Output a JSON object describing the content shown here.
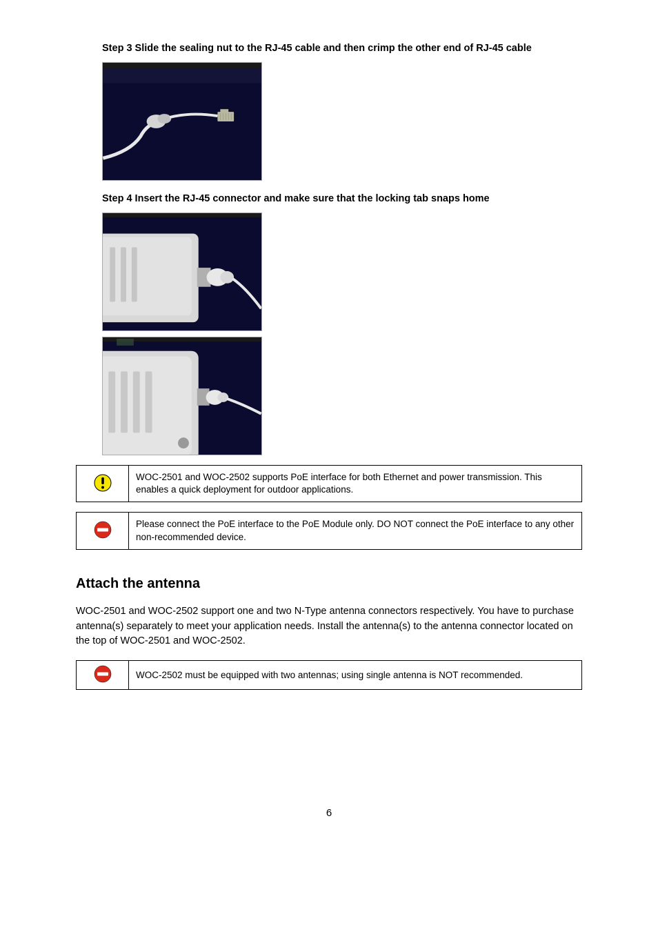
{
  "step3": {
    "header": "Step 3 Slide the sealing nut to the RJ-45 cable and then crimp the other end of RJ-45 cable",
    "alt": "RJ-45 cable with sealing nut and connector"
  },
  "step4": {
    "header": "Step 4 Insert the RJ-45 connector and make sure that the locking tab snaps home",
    "alt4a": "RJ-45 connector inserted into outdoor unit housing",
    "alt4b": "Outdoor unit with cable gland secured"
  },
  "callout_caution": {
    "label": "Caution icon",
    "text": "WOC-2501 and WOC-2502 supports PoE interface for both Ethernet and power transmission. This enables a quick deployment for outdoor applications."
  },
  "callout_notice1": {
    "label": "No-entry icon",
    "text": "Please connect the PoE interface to the PoE Module only. DO NOT connect the PoE interface to any other non-recommended device."
  },
  "section": {
    "title": "Attach the antenna",
    "para": "WOC-2501 and WOC-2502 support one and two N-Type antenna connectors respectively. You have to purchase antenna(s) separately to meet your application needs. Install the antenna(s) to the antenna connector located on the top of WOC-2501 and WOC-2502."
  },
  "callout_notice2": {
    "label": "No-entry icon",
    "text": "WOC-2502 must be equipped with two antennas; using single antenna is NOT recommended."
  },
  "footer": {
    "page": "6"
  }
}
